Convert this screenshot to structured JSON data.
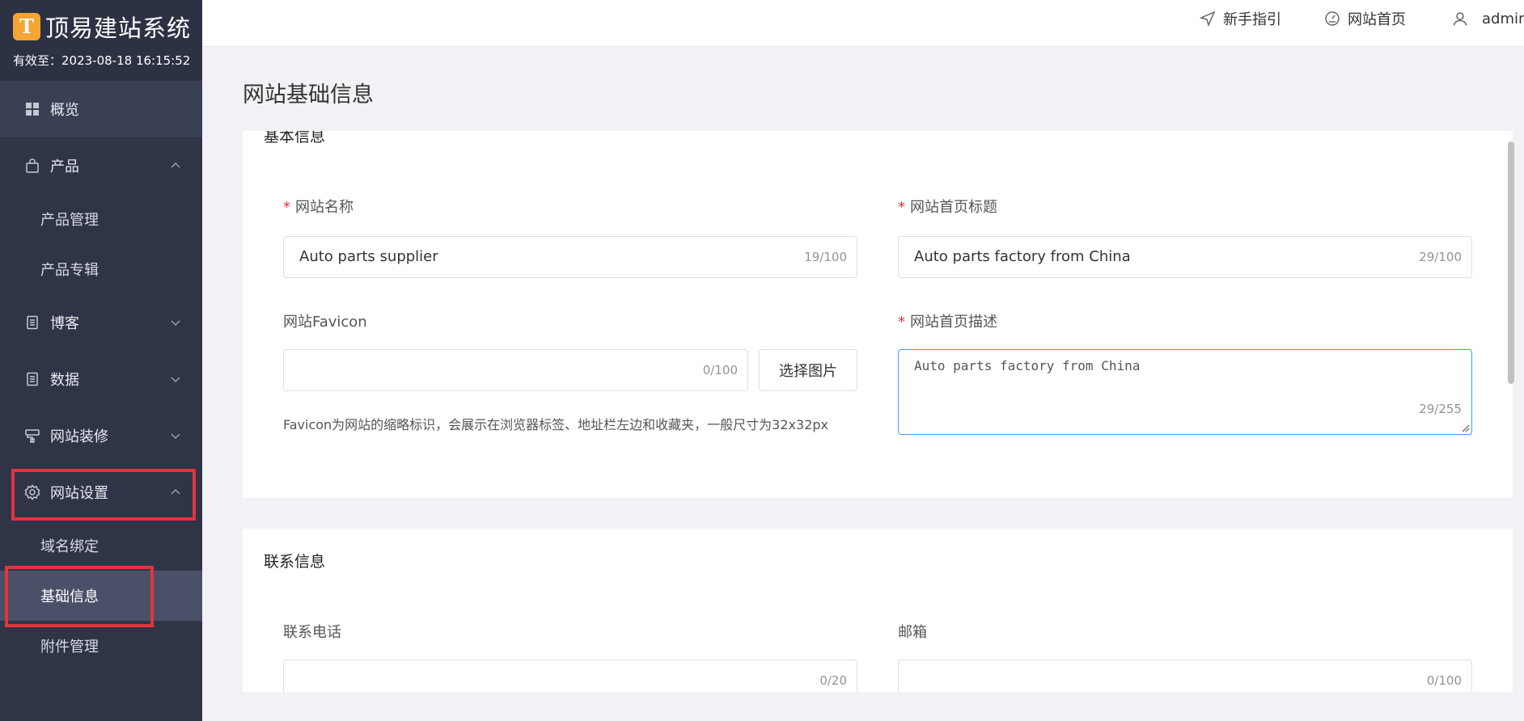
{
  "brand": {
    "logo_glyph": "T",
    "title": "顶易建站系统",
    "expiry": "有效至：2023-08-18 16:15:52"
  },
  "sidebar": {
    "items": [
      {
        "label": "概览",
        "icon": "grid-icon"
      },
      {
        "label": "产品",
        "icon": "bag-icon",
        "expanded": true
      },
      {
        "label": "产品管理"
      },
      {
        "label": "产品专辑"
      },
      {
        "label": "博客",
        "icon": "document-icon"
      },
      {
        "label": "数据",
        "icon": "document-icon"
      },
      {
        "label": "网站装修",
        "icon": "brush-icon"
      },
      {
        "label": "网站设置",
        "icon": "gear-icon",
        "expanded": true
      },
      {
        "label": "域名绑定"
      },
      {
        "label": "基础信息",
        "selected": true
      },
      {
        "label": "附件管理"
      }
    ]
  },
  "header": {
    "guide": "新手指引",
    "home": "网站首页",
    "user": "admin"
  },
  "main": {
    "page_title": "网站基础信息",
    "basic": {
      "title": "基本信息",
      "site_name_label": "网站名称",
      "site_name_value": "Auto parts supplier",
      "site_name_count": "19/100",
      "home_title_label": "网站首页标题",
      "home_title_value": "Auto parts factory from China",
      "home_title_count": "29/100",
      "favicon_label": "网站Favicon",
      "favicon_count": "0/100",
      "choose_image": "选择图片",
      "favicon_hint": "Favicon为网站的缩略标识，会展示在浏览器标签、地址栏左边和收藏夹，一般尺寸为32x32px",
      "desc_label": "网站首页描述",
      "desc_value": "Auto parts factory from China",
      "desc_count": "29/255"
    },
    "contact": {
      "title": "联系信息",
      "phone_label": "联系电话",
      "phone_count": "0/20",
      "email_label": "邮箱",
      "email_count": "0/100"
    }
  },
  "colors": {
    "sidebar_bg": "#2f3447",
    "highlight": "#e5333b",
    "required": "#e5333b",
    "focus_border": "#409eff"
  }
}
